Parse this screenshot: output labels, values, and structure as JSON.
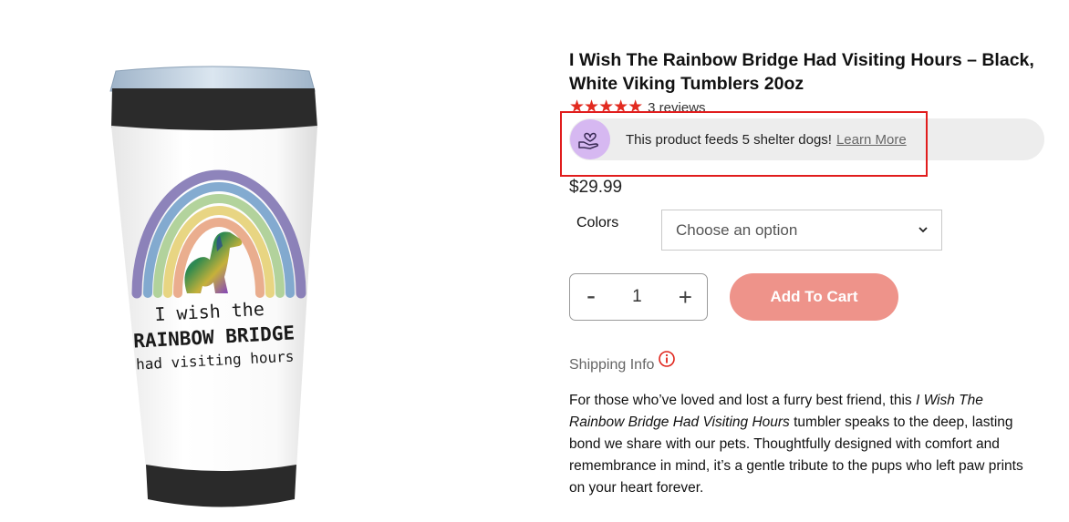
{
  "product": {
    "title": "I Wish The Rainbow Bridge Had Visiting Hours – Black, White Viking Tumblers 20oz",
    "image_text": {
      "line1": "I wish the",
      "line2": "RAINBOW BRIDGE",
      "line3": "had visiting hours"
    }
  },
  "rating": {
    "stars": "★★★★★",
    "value": 5,
    "reviews_label": "3 reviews"
  },
  "donation": {
    "icon": "heart-in-hand-icon",
    "text": "This product feeds 5 shelter dogs!",
    "link": "Learn More"
  },
  "price": "$29.99",
  "options": {
    "colors_label": "Colors",
    "select_value": "Choose an option"
  },
  "quantity": {
    "minus": "-",
    "value": "1",
    "plus": "+"
  },
  "cart": {
    "button_label": "Add To Cart"
  },
  "shipping": {
    "label": "Shipping Info",
    "icon": "info-icon"
  },
  "description": {
    "intro": "For those who’ve loved and lost a furry best friend, this ",
    "product_name": "I Wish The Rainbow Bridge Had Visiting Hours",
    "rest": " tumbler speaks to the deep, lasting bond we share with our pets. Thoughtfully designed with comfort and remembrance in mind, it’s a gentle tribute to the pups who left paw prints on your heart forever."
  },
  "colors": {
    "accent_button": "#ee938a",
    "stars": "#e22a1f",
    "highlight_border": "#e11d1d",
    "badge": "#d6b8f1",
    "pill": "#ededed"
  }
}
